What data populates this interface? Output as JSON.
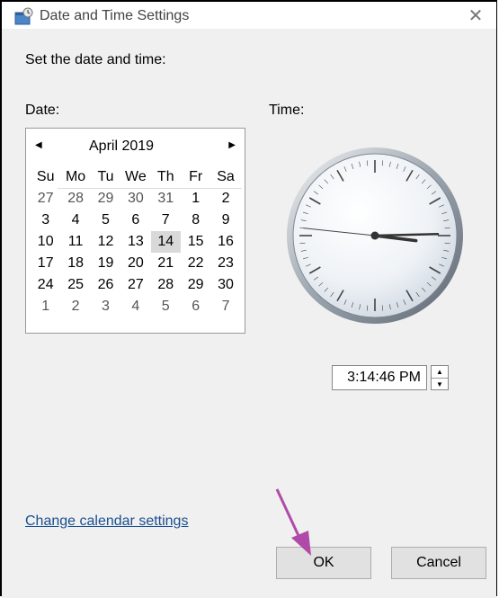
{
  "window": {
    "title": "Date and Time Settings",
    "close_symbol": "✕"
  },
  "instruction": "Set the date and time:",
  "date_label": "Date:",
  "time_label": "Time:",
  "calendar": {
    "prev_symbol": "◀",
    "next_symbol": "▶",
    "month_year": "April  2019",
    "weekdays": [
      "Su",
      "Mo",
      "Tu",
      "We",
      "Th",
      "Fr",
      "Sa"
    ],
    "weeks": [
      [
        "27",
        "28",
        "29",
        "30",
        "31",
        "1",
        "2"
      ],
      [
        "3",
        "4",
        "5",
        "6",
        "7",
        "8",
        "9"
      ],
      [
        "10",
        "11",
        "12",
        "13",
        "14",
        "15",
        "16"
      ],
      [
        "17",
        "18",
        "19",
        "20",
        "21",
        "22",
        "23"
      ],
      [
        "24",
        "25",
        "26",
        "27",
        "28",
        "29",
        "30"
      ],
      [
        "1",
        "2",
        "3",
        "4",
        "5",
        "6",
        "7"
      ]
    ],
    "selected_day": "14"
  },
  "clock": {
    "hour": 3,
    "minute": 14,
    "second": 46
  },
  "time_value": "3:14:46 PM",
  "spinner": {
    "up": "▲",
    "down": "▼"
  },
  "change_calendar_link": "Change calendar settings",
  "buttons": {
    "ok": "OK",
    "cancel": "Cancel"
  },
  "colors": {
    "link": "#1a4f8f",
    "arrow": "#b04aa8",
    "selected": "#d9d9d9"
  }
}
